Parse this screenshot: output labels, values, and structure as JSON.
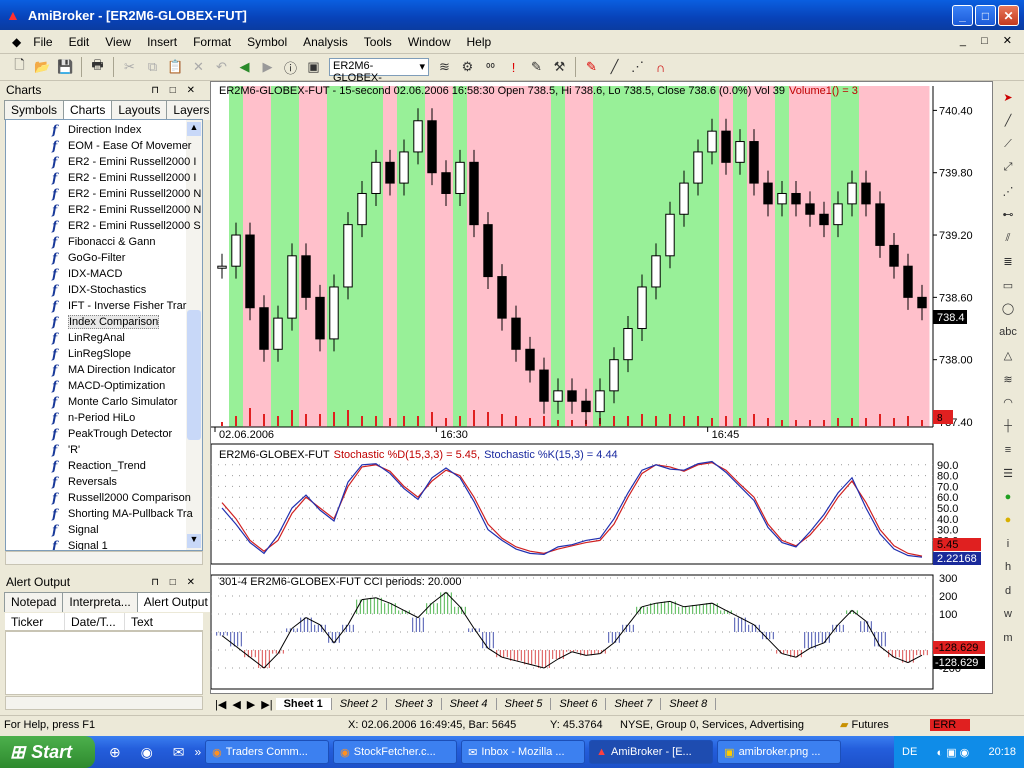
{
  "window": {
    "title": "AmiBroker - [ER2M6-GLOBEX-FUT]"
  },
  "menu": [
    "File",
    "Edit",
    "View",
    "Insert",
    "Format",
    "Symbol",
    "Analysis",
    "Tools",
    "Window",
    "Help"
  ],
  "toolbar": {
    "symbol": "ER2M6-GLOBEX-"
  },
  "charts_panel": {
    "title": "Charts",
    "tabs": [
      "Symbols",
      "Charts",
      "Layouts",
      "Layers"
    ],
    "active_tab": "Charts",
    "items": [
      "Direction Index",
      "EOM - Ease Of Movemer",
      "ER2 - Emini Russell2000 I",
      "ER2 - Emini Russell2000 I",
      "ER2 - Emini Russell2000 N",
      "ER2 - Emini Russell2000 N",
      "ER2 - Emini Russell2000 S",
      "Fibonacci & Gann",
      "GoGo-Filter",
      "IDX-MACD",
      "IDX-Stochastics",
      "IFT - Inverse Fisher Trar",
      "Index Comparison",
      "LinRegAnal",
      "LinRegSlope",
      "MA Direction Indicator",
      "MACD-Optimization",
      "Monte Carlo Simulator",
      "n-Period HiLo",
      "PeakTrough Detector",
      "'R'",
      "Reaction_Trend",
      "Reversals",
      "Russell2000 Comparison",
      "Shorting MA-Pullback Tra",
      "Signal",
      "Signal 1"
    ],
    "selected": "Index Comparison"
  },
  "alert_panel": {
    "title": "Alert Output",
    "tabs": [
      "Notepad",
      "Interpreta...",
      "Alert Output"
    ],
    "active_tab": "Alert Output",
    "columns": [
      "Ticker",
      "Date/T...",
      "Text"
    ]
  },
  "price_pane": {
    "header_main": "ER2M6-GLOBEX-FUT - 15-second 02.06.2006 16:58:30 Open 738.5, Hi 738.6, Lo 738.5, Close 738.6 (0.0%) Vol 39",
    "header_vol": "Volume1() = 3",
    "last_price": "738.4",
    "vol_tag": "8",
    "y_ticks": [
      "740.40",
      "739.80",
      "739.20",
      "738.60",
      "738.00",
      "737.40"
    ],
    "x_ticks": [
      "02.06.2006",
      "16:30",
      "16:45"
    ],
    "colors": {
      "up_band": "#98f098",
      "down_band": "#ffc0cb",
      "volume": "#e02020"
    }
  },
  "stoch_pane": {
    "header_sym": "ER2M6-GLOBEX-FUT",
    "header_d": "Stochastic %D(15,3,3) = 5.45,",
    "header_k": "Stochastic %K(15,3) = 4.44",
    "y_ticks": [
      "90.0",
      "80.0",
      "70.0",
      "60.0",
      "50.0",
      "40.0",
      "30.0",
      "20.0"
    ],
    "tag_red": "5.45",
    "tag_blue": "2.22168"
  },
  "cci_pane": {
    "header": "301-4  ER2M6-GLOBEX-FUT    CCI  periods:  20.000",
    "y_ticks": [
      "300",
      "200",
      "100",
      "-100",
      "-200"
    ],
    "tag_red": "-128.629",
    "tag_black": "-128.629"
  },
  "chart_data": [
    {
      "type": "candlestick",
      "title": "ER2M6-GLOBEX-FUT - 15-second",
      "ylim": [
        737.4,
        740.5
      ],
      "close": [
        738.9,
        739.2,
        738.5,
        738.1,
        738.4,
        739.0,
        738.6,
        738.2,
        738.7,
        739.3,
        739.6,
        739.9,
        739.7,
        740.0,
        740.3,
        739.8,
        739.6,
        739.9,
        739.3,
        738.8,
        738.4,
        738.1,
        737.9,
        737.6,
        737.7,
        737.6,
        737.5,
        737.7,
        738.0,
        738.3,
        738.7,
        739.0,
        739.4,
        739.7,
        740.0,
        740.2,
        739.9,
        740.1,
        739.7,
        739.5,
        739.6,
        739.5,
        739.4,
        739.3,
        739.5,
        739.7,
        739.5,
        739.1,
        738.9,
        738.6,
        738.5
      ]
    },
    {
      "type": "line",
      "title": "Stochastic",
      "ylim": [
        0,
        100
      ],
      "series": [
        {
          "name": "Stochastic %D(15,3,3)",
          "values": [
            55,
            40,
            20,
            10,
            20,
            45,
            60,
            50,
            40,
            70,
            88,
            90,
            84,
            70,
            60,
            75,
            85,
            80,
            60,
            35,
            22,
            14,
            10,
            8,
            12,
            15,
            18,
            20,
            35,
            60,
            82,
            90,
            88,
            84,
            90,
            92,
            85,
            72,
            60,
            35,
            20,
            15,
            25,
            40,
            60,
            75,
            55,
            30,
            15,
            8,
            5.45
          ]
        },
        {
          "name": "Stochastic %K(15,3)",
          "values": [
            50,
            35,
            18,
            8,
            25,
            50,
            62,
            48,
            38,
            74,
            90,
            91,
            82,
            68,
            58,
            78,
            87,
            78,
            56,
            30,
            20,
            12,
            8,
            7,
            14,
            16,
            20,
            22,
            40,
            64,
            85,
            90,
            86,
            85,
            91,
            93,
            83,
            70,
            57,
            32,
            18,
            14,
            28,
            44,
            64,
            78,
            50,
            26,
            12,
            6,
            4.44
          ]
        }
      ]
    },
    {
      "type": "area",
      "title": "CCI",
      "ylim": [
        -300,
        300
      ],
      "series": [
        {
          "name": "CCI",
          "values": [
            -20,
            -80,
            -140,
            -200,
            -120,
            20,
            80,
            40,
            -60,
            40,
            180,
            190,
            160,
            120,
            80,
            160,
            220,
            140,
            20,
            -90,
            -140,
            -160,
            -180,
            -200,
            -150,
            -110,
            -130,
            -120,
            -60,
            40,
            140,
            160,
            170,
            140,
            150,
            160,
            120,
            80,
            40,
            -40,
            -120,
            -140,
            -90,
            -60,
            40,
            120,
            60,
            -80,
            -140,
            -170,
            -128.629
          ]
        }
      ]
    }
  ],
  "sheet_tabs": [
    "Sheet 1",
    "Sheet 2",
    "Sheet 3",
    "Sheet 4",
    "Sheet 5",
    "Sheet 6",
    "Sheet 7",
    "Sheet 8"
  ],
  "status": {
    "help": "For Help, press F1",
    "cursor": "X: 02.06.2006 16:49:45, Bar: 5645",
    "y": "Y: 45.3764",
    "market": "NYSE, Group 0, Services, Advertising",
    "category": "Futures",
    "err": "ERR"
  },
  "taskbar": {
    "start": "Start",
    "tasks": [
      "Traders Comm...",
      "StockFetcher.c...",
      "Inbox - Mozilla ...",
      "AmiBroker - [E...",
      "amibroker.png ..."
    ],
    "active_task": "AmiBroker - [E...",
    "lang": "DE",
    "clock": "20:18"
  }
}
